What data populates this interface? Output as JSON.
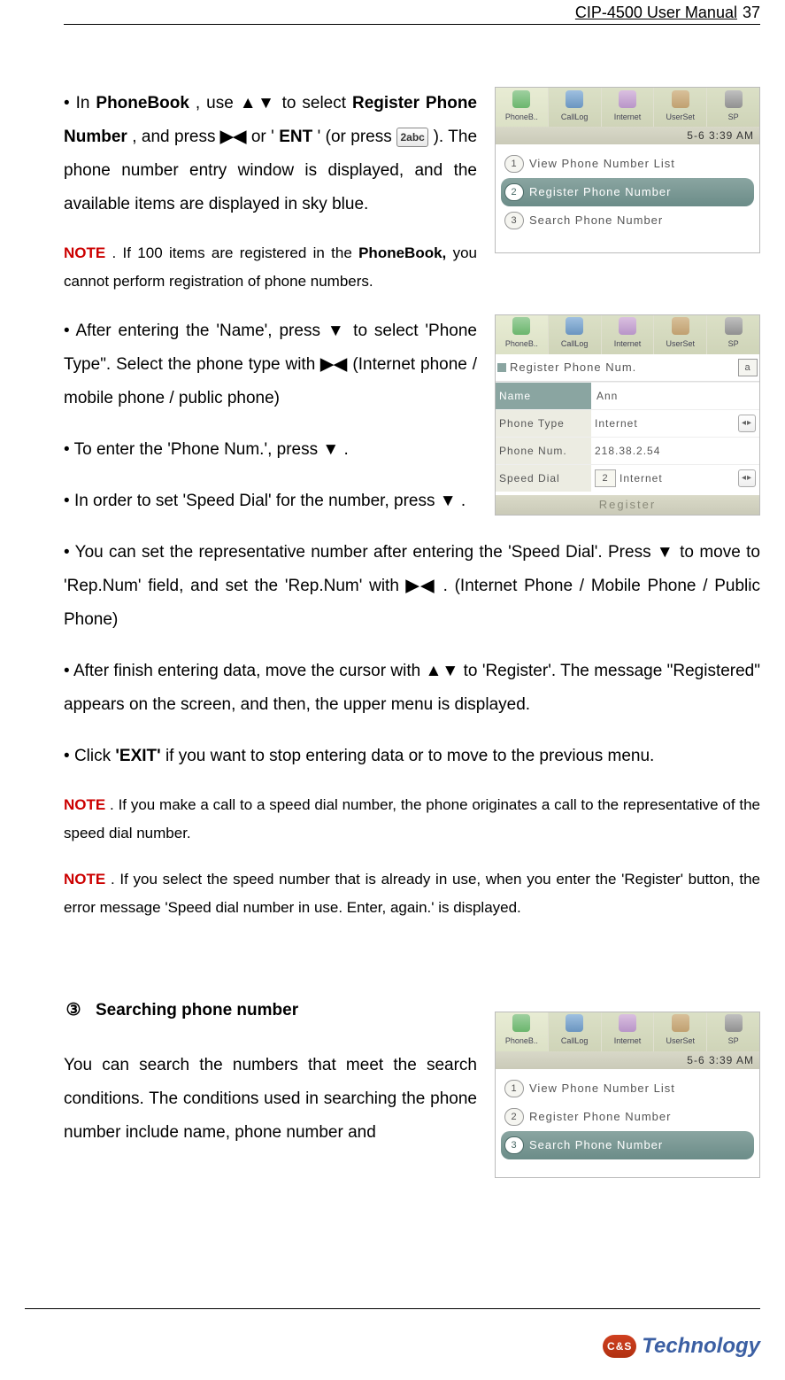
{
  "header": {
    "title": "CIP-4500 User Manual",
    "page_number": "37"
  },
  "arrows": {
    "updown": "▲▼",
    "leftright": "▶◀",
    "down": "▼"
  },
  "key_icon": "2abc",
  "paragraphs": {
    "p1_a": "In ",
    "p1_phonebook": "PhoneBook",
    "p1_b": ", use ",
    "p1_c": " to select ",
    "p1_register_phone_number": "Register Phone Number",
    "p1_d": ", and press ",
    "p1_e": " or '",
    "p1_ent": "ENT",
    "p1_f": "' (or press ",
    "p1_g": "). The phone number entry window is displayed, and the available items are displayed in sky blue.",
    "note1_label": "NOTE",
    "note1_a": ". If 100 items are registered in the ",
    "note1_phonebook": "PhoneBook,",
    "note1_b": " you cannot perform registration of phone numbers.",
    "p2_a": "After entering the 'Name', press ",
    "p2_b": " to select 'Phone Type\". Select the phone type with ",
    "p2_c": " (Internet phone / mobile phone / public phone)",
    "p3_a": "To enter the 'Phone Num.', press ",
    "p3_b": ".",
    "p4_a": "In order to set 'Speed Dial' for the number, press ",
    "p4_b": ".",
    "p5_a": "You can set the representative number after entering the 'Speed Dial'. Press ",
    "p5_b": " to move to 'Rep.Num' field, and set the 'Rep.Num' with ",
    "p5_c": ". (Internet Phone / Mobile Phone / Public Phone)",
    "p6_a": "After finish entering data, move the cursor with ",
    "p6_b": " to 'Register'. The message \"Registered\" appears on the screen, and then, the upper menu is displayed.",
    "p7_a": "Click ",
    "p7_exit": "'EXIT'",
    "p7_b": " if you want to stop entering data or to move to the previous menu.",
    "note2_label": "NOTE",
    "note2_a": ". If you make a call to a speed dial number, the phone originates a call to the representative of the speed dial number.",
    "note3_label": "NOTE",
    "note3_a": ". If you select the speed number that is already in use, when you enter the 'Register' button, the error message 'Speed dial number in use. Enter, again.' is displayed."
  },
  "section3": {
    "marker": "③",
    "heading": "Searching phone number",
    "body": "You can search the numbers that meet the search conditions. The conditions used in searching the phone number include name, phone number and"
  },
  "shot_a": {
    "status": "5-6  3:39 AM",
    "tabs": [
      "PhoneB..",
      "CallLog",
      "Internet",
      "UserSet",
      "SP"
    ],
    "menu": {
      "item1_num": "1",
      "item1_label": "View Phone Number List",
      "item2_num": "2",
      "item2_label": "Register Phone Number",
      "item3_num": "3",
      "item3_label": "Search Phone Number"
    }
  },
  "shot_b": {
    "tabs": [
      "PhoneB..",
      "CallLog",
      "Internet",
      "UserSet",
      "SP"
    ],
    "title": "Register Phone Num.",
    "title_badge": "a",
    "row_name_label": "Name",
    "row_name_value": "Ann",
    "row_type_label": "Phone Type",
    "row_type_value": "Internet",
    "row_num_label": "Phone Num.",
    "row_num_value": "218.38.2.54",
    "row_speed_label": "Speed Dial",
    "row_speed_value1": "2",
    "row_speed_value2": "Internet",
    "register": "Register"
  },
  "shot_c": {
    "status": "5-6  3:39 AM",
    "tabs": [
      "PhoneB..",
      "CallLog",
      "Internet",
      "UserSet",
      "SP"
    ],
    "menu": {
      "item1_num": "1",
      "item1_label": "View Phone Number List",
      "item2_num": "2",
      "item2_label": "Register Phone Number",
      "item3_num": "3",
      "item3_label": "Search Phone Number"
    }
  },
  "footer": {
    "badge": "C&S",
    "brand": "Technology"
  }
}
